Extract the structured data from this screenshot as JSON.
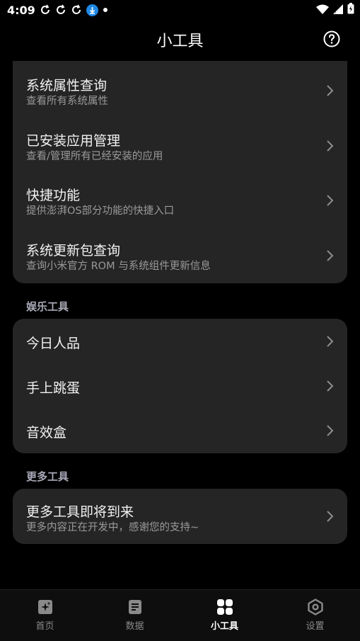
{
  "status_bar": {
    "time": "4:09",
    "notification_icons": [
      "sync-icon",
      "sync-icon",
      "sync-icon",
      "download-icon",
      "dot-icon"
    ],
    "right_icons": [
      "wifi-icon",
      "signal-icon",
      "battery-icon"
    ]
  },
  "app_bar": {
    "title": "小工具",
    "help_icon": "help-circle-icon"
  },
  "system_tools": [
    {
      "title": "系统属性查询",
      "subtitle": "查看所有系统属性"
    },
    {
      "title": "已安装应用管理",
      "subtitle": "查看/管理所有已经安装的应用"
    },
    {
      "title": "快捷功能",
      "subtitle": "提供澎湃OS部分功能的快捷入口"
    },
    {
      "title": "系统更新包查询",
      "subtitle": "查询小米官方 ROM 与系统组件更新信息"
    }
  ],
  "entertainment": {
    "label": "娱乐工具",
    "items": [
      {
        "title": "今日人品"
      },
      {
        "title": "手上跳蛋"
      },
      {
        "title": "音效盒"
      }
    ]
  },
  "more": {
    "label": "更多工具",
    "items": [
      {
        "title": "更多工具即将到来",
        "subtitle": "更多内容正在开发中，感谢您的支持~"
      }
    ]
  },
  "bottom_nav": [
    {
      "label": "首页",
      "icon": "home-sparkle-icon",
      "active": false
    },
    {
      "label": "数据",
      "icon": "document-icon",
      "active": false
    },
    {
      "label": "小工具",
      "icon": "grid-icon",
      "active": true
    },
    {
      "label": "设置",
      "icon": "settings-hexagon-icon",
      "active": false
    }
  ],
  "colors": {
    "background": "#000000",
    "card": "#252525",
    "section_label": "#a9a9b8",
    "subtitle": "#9a9a9a"
  }
}
